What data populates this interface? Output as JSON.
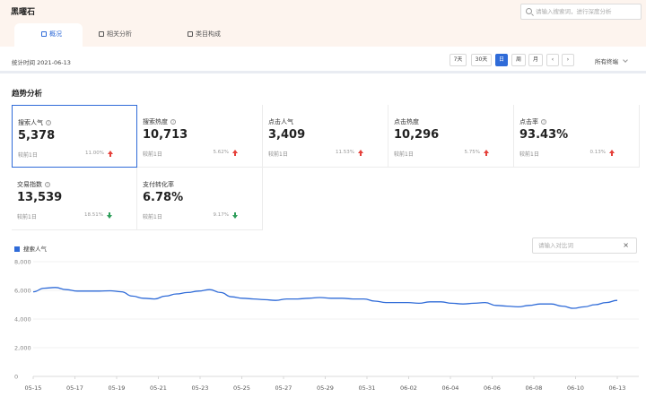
{
  "app": {
    "title": "黑曜石"
  },
  "search": {
    "placeholder": "请输入搜索词，进行深度分析"
  },
  "tabs": [
    {
      "label": "概况",
      "active": true
    },
    {
      "label": "相关分析",
      "active": false
    },
    {
      "label": "类目构成",
      "active": false
    }
  ],
  "date_bar": {
    "stat_time": "统计时间 2021-06-13",
    "periods": [
      "7天",
      "30天",
      "日",
      "周",
      "月"
    ],
    "active_period": "日",
    "prev": "‹",
    "next": "›",
    "terminal": "所有终端"
  },
  "section": {
    "title": "趋势分析"
  },
  "metrics": [
    {
      "label": "搜索人气",
      "value": "5,378",
      "compare": "较前1日",
      "change": "11.00%",
      "direction": "up",
      "selected": true,
      "help": true
    },
    {
      "label": "搜索热度",
      "value": "10,713",
      "compare": "较前1日",
      "change": "5.62%",
      "direction": "up",
      "selected": false,
      "help": true
    },
    {
      "label": "点击人气",
      "value": "3,409",
      "compare": "较前1日",
      "change": "11.53%",
      "direction": "up",
      "selected": false,
      "help": false
    },
    {
      "label": "点击热度",
      "value": "10,296",
      "compare": "较前1日",
      "change": "5.75%",
      "direction": "up",
      "selected": false,
      "help": false
    },
    {
      "label": "点击率",
      "value": "93.43%",
      "compare": "较前1日",
      "change": "0.13%",
      "direction": "up",
      "selected": false,
      "help": true
    },
    {
      "label": "交易指数",
      "value": "13,539",
      "compare": "较前1日",
      "change": "18.51%",
      "direction": "down",
      "selected": false,
      "help": true
    },
    {
      "label": "支付转化率",
      "value": "6.78%",
      "compare": "较前1日",
      "change": "9.17%",
      "direction": "down",
      "selected": false,
      "help": false
    }
  ],
  "compare_input": {
    "placeholder": "请输入对比词",
    "clear": "×"
  },
  "colors": {
    "accent": "#2f6bd8",
    "up": "#e5403a",
    "down": "#2e9e5a"
  },
  "chart_data": {
    "type": "line",
    "series": [
      {
        "name": "搜索人气",
        "values": [
          5900,
          6150,
          6200,
          6050,
          5950,
          5950,
          5950,
          5970,
          5900,
          5600,
          5450,
          5400,
          5600,
          5750,
          5850,
          5950,
          6050,
          5850,
          5550,
          5450,
          5400,
          5350,
          5300,
          5400,
          5400,
          5450,
          5500,
          5450,
          5450,
          5400,
          5400,
          5250,
          5150,
          5150,
          5150,
          5100,
          5200,
          5200,
          5100,
          5050,
          5100,
          5150,
          4950,
          4900,
          4850,
          4950,
          5050,
          5050,
          4900,
          4750,
          4850,
          5000,
          5150,
          5300
        ]
      }
    ],
    "x_tick_labels": [
      "05-15",
      "05-17",
      "05-19",
      "05-21",
      "05-23",
      "05-25",
      "05-27",
      "05-29",
      "05-31",
      "06-02",
      "06-04",
      "06-06",
      "06-08",
      "06-10",
      "06-13"
    ],
    "y_tick_labels": [
      "0",
      "2,000",
      "4,000",
      "6,000",
      "8,000"
    ],
    "ylim": [
      0,
      8000
    ],
    "grid": true,
    "legend": "top-left"
  }
}
